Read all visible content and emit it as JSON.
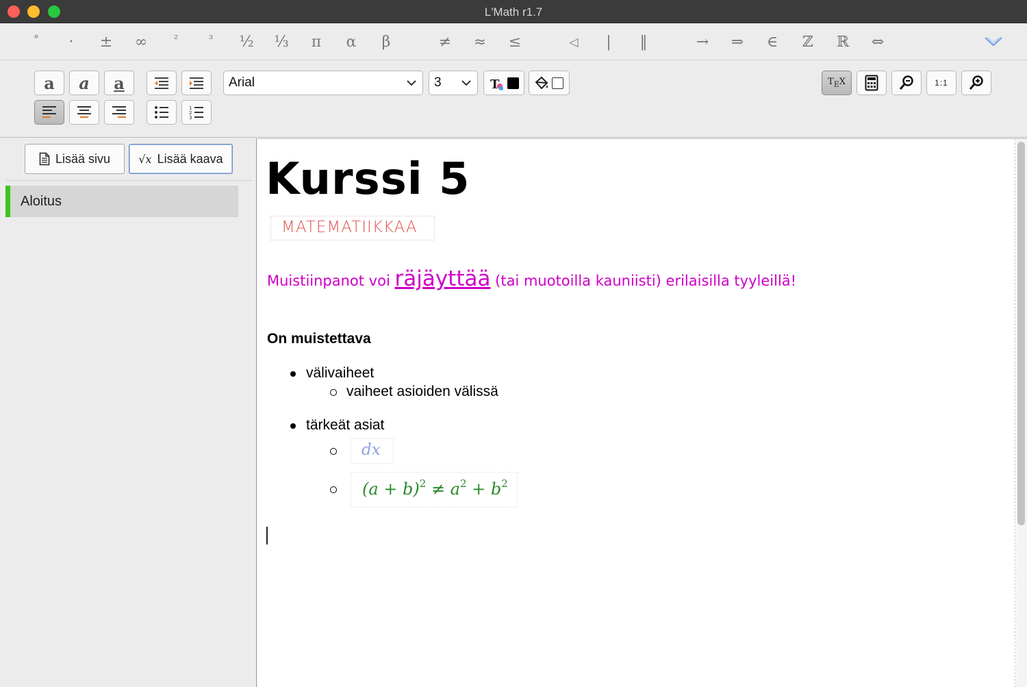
{
  "window": {
    "title": "L'Math r1.7"
  },
  "symbols": [
    "°",
    "·",
    "±",
    "∞",
    "²",
    "³",
    "½",
    "⅓",
    "π",
    "α",
    "β",
    "≠",
    "≈",
    "≤",
    "◁",
    "|",
    "‖",
    "→",
    "⇒",
    "∈",
    "ℤ",
    "ℝ",
    "⇔"
  ],
  "format_toolbar": {
    "bold_letter": "a",
    "italic_letter": "a",
    "underline_letter": "a",
    "font_family": "Arial",
    "font_size": "3",
    "text_color": "#000000",
    "fill_color": "#ffffff",
    "zoom_reset_label": "1:1"
  },
  "sidebar": {
    "add_page_label": "Lisää sivu",
    "add_formula_label": "Lisää kaava",
    "add_formula_icon_text": "√x",
    "pages": [
      {
        "label": "Aloitus",
        "accent": "#3cc41e"
      }
    ]
  },
  "document": {
    "heading": "Kurssi 5",
    "subtitle": "MATEMATIIKKAA",
    "notes": {
      "before": "Muistiinpanot voi ",
      "big": "räjäyttää",
      "after": " (tai muotoilla kauniisti) erilaisilla tyyleillä!",
      "color": "#cf00c8"
    },
    "section_heading": "On muistettava",
    "list": [
      {
        "text": "välivaiheet",
        "children": [
          {
            "text": "vaiheet asioiden välissä"
          }
        ]
      },
      {
        "text": "tärkeät asiat",
        "children": [
          {
            "formula": "dx",
            "color": "#8fa3e3"
          },
          {
            "formula_parts": [
              "(a + b)",
              "2",
              " ≠ a",
              "2",
              " + b",
              "2"
            ],
            "color": "#2a8a2a"
          }
        ]
      }
    ]
  }
}
